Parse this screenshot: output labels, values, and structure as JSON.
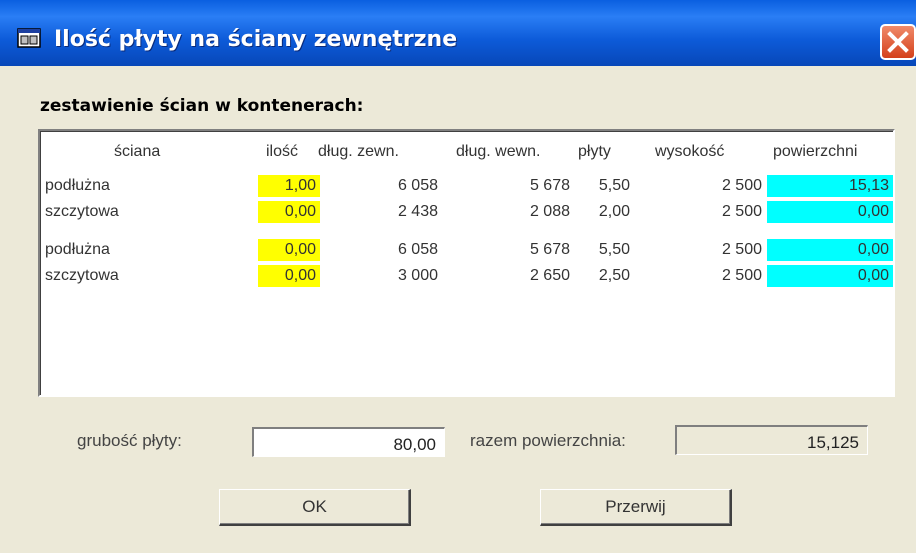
{
  "window": {
    "title": "Ilość płyty na ściany zewnętrzne"
  },
  "section_label": "zestawienie ścian w kontenerach:",
  "table": {
    "columns": [
      "ściana",
      "ilość",
      "dług. zewn.",
      "dług. wewn.",
      "płyty",
      "wysokość",
      "powierzchni"
    ],
    "rows": [
      [
        "podłużna",
        "1,00",
        "6 058",
        "5 678",
        "5,50",
        "2 500",
        "15,13"
      ],
      [
        "szczytowa",
        "0,00",
        "2 438",
        "2 088",
        "2,00",
        "2 500",
        "0,00"
      ],
      [
        "podłużna",
        "0,00",
        "6 058",
        "5 678",
        "5,50",
        "2 500",
        "0,00"
      ],
      [
        "szczytowa",
        "0,00",
        "3 000",
        "2 650",
        "2,50",
        "2 500",
        "0,00"
      ]
    ]
  },
  "thickness": {
    "label": "grubość płyty:",
    "value": "80,00"
  },
  "total": {
    "label": "razem powierzchnia:",
    "value": "15,125"
  },
  "buttons": {
    "ok": "OK",
    "cancel": "Przerwij"
  },
  "colors": {
    "title_bar": "#0a5fe0",
    "quantity_highlight": "#ffff00",
    "area_highlight": "#00ffff",
    "close_button": "#d4401a"
  },
  "icons": {
    "window": "window-icon",
    "close": "close-icon"
  }
}
